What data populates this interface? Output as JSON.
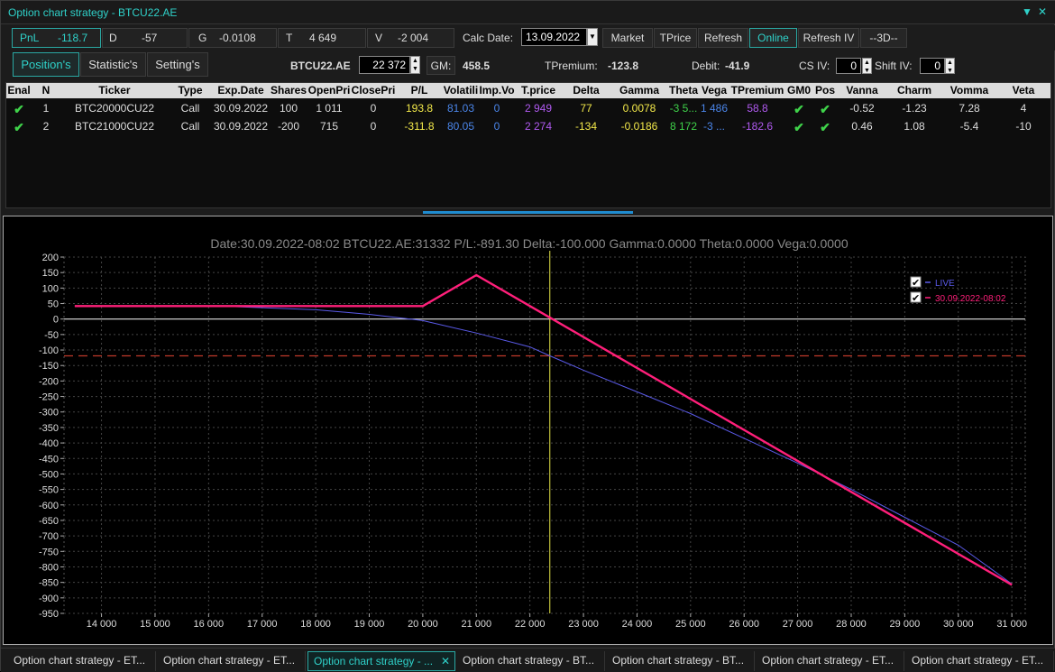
{
  "window": {
    "title": "Option chart strategy - BTCU22.AE"
  },
  "stats": {
    "pnl_label": "PnL",
    "pnl_value": "-118.7",
    "d_label": "D",
    "d_value": "-57",
    "g_label": "G",
    "g_value": "-0.0108",
    "t_label": "T",
    "t_value": "4 649",
    "v_label": "V",
    "v_value": "-2 004"
  },
  "calc": {
    "label": "Calc Date:",
    "value": "13.09.2022"
  },
  "buttons": {
    "market": "Market",
    "tprice": "TPrice",
    "refresh": "Refresh",
    "online": "Online",
    "refresh_iv": "Refresh IV",
    "three_d": "--3D--"
  },
  "tabs": {
    "positions": "Position's",
    "statistics": "Statistic's",
    "settings": "Setting's"
  },
  "instrument": {
    "ticker": "BTCU22.AE",
    "price": "22 372",
    "gm_label": "GM:",
    "gm_value": "458.5"
  },
  "summary": {
    "tpremium_label": "TPremium:",
    "tpremium_value": "-123.8",
    "debit_label": "Debit:",
    "debit_value": "-41.9",
    "csiv_label": "CS IV:",
    "csiv_value": "0",
    "shiftiv_label": "Shift IV:",
    "shiftiv_value": "0"
  },
  "table": {
    "headers": [
      "Enal",
      "N",
      "Ticker",
      "Type",
      "Exp.Date",
      "Shares",
      "OpenPri",
      "ClosePri",
      "P/L",
      "Volatili",
      "Imp.Vo",
      "T.price",
      "Delta",
      "Gamma",
      "Theta",
      "Vega",
      "TPremium",
      "GM0",
      "Pos",
      "Vanna",
      "Charm",
      "Vomma",
      "Veta"
    ],
    "rows": [
      {
        "n": "1",
        "ticker": "BTC20000CU22",
        "type": "Call",
        "exp": "30.09.2022",
        "shares": "100",
        "open": "1 011",
        "close": "0",
        "pl": "193.8",
        "vol": "81.03",
        "impvol": "0",
        "tprice": "2 949",
        "delta": "77",
        "gamma": "0.0078",
        "theta": "-3 5...",
        "vega": "1 486",
        "tpremium": "58.8",
        "vanna": "-0.52",
        "charm": "-1.23",
        "vomma": "7.28",
        "veta": "4"
      },
      {
        "n": "2",
        "ticker": "BTC21000CU22",
        "type": "Call",
        "exp": "30.09.2022",
        "shares": "-200",
        "open": "715",
        "close": "0",
        "pl": "-311.8",
        "vol": "80.05",
        "impvol": "0",
        "tprice": "2 274",
        "delta": "-134",
        "gamma": "-0.0186",
        "theta": "8 172",
        "vega": "-3 ...",
        "tpremium": "-182.6",
        "vanna": "0.46",
        "charm": "1.08",
        "vomma": "-5.4",
        "veta": "-10"
      }
    ]
  },
  "chart_data": {
    "type": "line",
    "title": "Date:30.09.2022-08:02  BTCU22.AE:31332  P/L:-891.30  Delta:-100.000  Gamma:0.0000  Theta:0.0000  Vega:0.0000",
    "xlim": [
      13300,
      31250
    ],
    "ylim": [
      -950,
      200
    ],
    "x_ticks": [
      "14 000",
      "15 000",
      "16 000",
      "17 000",
      "18 000",
      "19 000",
      "20 000",
      "21 000",
      "22 000",
      "23 000",
      "24 000",
      "25 000",
      "26 000",
      "27 000",
      "28 000",
      "29 000",
      "30 000",
      "31 000"
    ],
    "y_ticks": [
      "200",
      "150",
      "100",
      "50",
      "0",
      "-50",
      "-100",
      "-150",
      "-200",
      "-250",
      "-300",
      "-350",
      "-400",
      "-450",
      "-500",
      "-550",
      "-600",
      "-650",
      "-700",
      "-750",
      "-800",
      "-850",
      "-900",
      "-950"
    ],
    "legend_placement": "top-right",
    "series": [
      {
        "name": "LIVE",
        "color": "#5a5ae8",
        "points": [
          [
            13500,
            41.9
          ],
          [
            16500,
            40
          ],
          [
            18000,
            30
          ],
          [
            19000,
            15
          ],
          [
            20000,
            -5
          ],
          [
            21000,
            -45
          ],
          [
            22000,
            -90
          ],
          [
            22372,
            -118.7
          ],
          [
            23000,
            -165
          ],
          [
            24000,
            -235
          ],
          [
            25000,
            -305
          ],
          [
            26000,
            -385
          ],
          [
            27000,
            -465
          ],
          [
            28000,
            -550
          ],
          [
            29000,
            -640
          ],
          [
            30000,
            -730
          ],
          [
            31000,
            -855
          ]
        ]
      },
      {
        "name": "30.09.2022-08:02",
        "color": "#ff1f7a",
        "points": [
          [
            13500,
            41.9
          ],
          [
            20000,
            41.9
          ],
          [
            21000,
            141.9
          ],
          [
            22419,
            0
          ],
          [
            31000,
            -858.1
          ]
        ]
      }
    ],
    "spot_line_x": 22372,
    "pnl_level": -118.7,
    "grid": true
  },
  "taskbar": {
    "items": [
      "Option chart strategy - ET...",
      "Option chart strategy - ET...",
      "Option chart strategy - ...",
      "Option chart strategy - BT...",
      "Option chart strategy - BT...",
      "Option chart strategy - ET...",
      "Option chart strategy - ET..."
    ]
  }
}
